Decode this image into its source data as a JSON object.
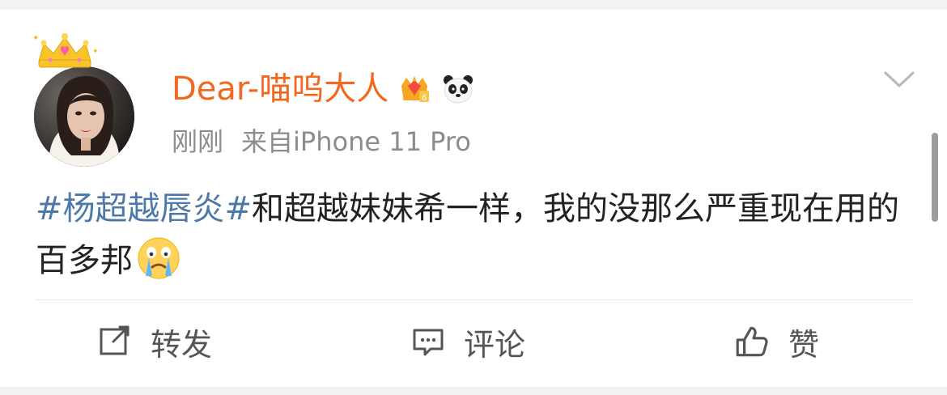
{
  "post": {
    "username": "Dear-喵呜大人",
    "time": "刚刚",
    "source": "来自iPhone 11 Pro",
    "hashtag": "#杨超越唇炎#",
    "body": "和超越妹妹希一样，我的没那么严重现在用的百多邦",
    "badges": [
      "vip-crown-badge",
      "panda-badge"
    ],
    "emoji": "crying-emoji"
  },
  "actions": {
    "repost_label": "转发",
    "comment_label": "评论",
    "like_label": "赞"
  },
  "colors": {
    "username": "#f0691f",
    "hashtag": "#4e78a8",
    "body_text": "#222222",
    "meta_text": "#8c8c8c",
    "background": "#f2f2f2"
  }
}
